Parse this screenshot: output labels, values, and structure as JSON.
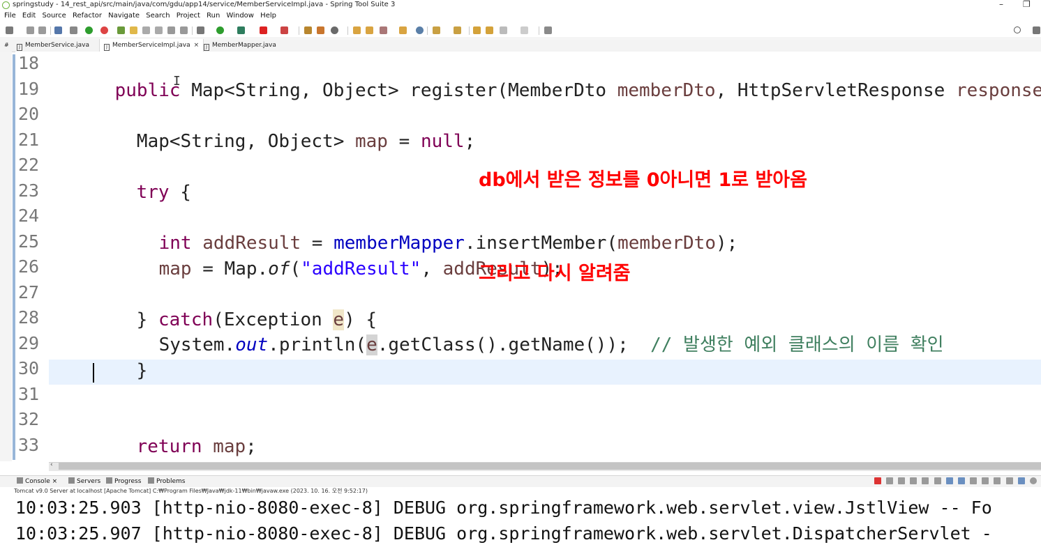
{
  "window": {
    "title": "springstudy - 14_rest_api/src/main/java/com/gdu/app14/service/MemberServiceImpl.java - Spring Tool Suite 3",
    "minimize": "–",
    "restore": "❐"
  },
  "menu": [
    "File",
    "Edit",
    "Source",
    "Refactor",
    "Navigate",
    "Search",
    "Project",
    "Run",
    "Window",
    "Help"
  ],
  "tabs": [
    {
      "label": "MemberService.java",
      "active": false
    },
    {
      "label": "MemberServiceImpl.java",
      "active": true
    },
    {
      "label": "MemberMapper.java",
      "active": false
    }
  ],
  "editor": {
    "line_numbers": [
      "18",
      "19",
      "20",
      "21",
      "22",
      "23",
      "24",
      "25",
      "26",
      "27",
      "28",
      "29",
      "30",
      "31",
      "32",
      "33"
    ],
    "code": {
      "l18": {
        "kw": "public",
        "t1": " Map<String, Object> register(MemberDto ",
        "v1": "memberDto",
        "t2": ", HttpServletResponse ",
        "v2": "response",
        "t3": ") {"
      },
      "l20": {
        "t1": "  Map<String, Object> ",
        "v1": "map",
        "t2": " = ",
        "kw": "null",
        "t3": ";"
      },
      "l22": {
        "kw": "try",
        "t1": " {"
      },
      "l24": {
        "kw": "int",
        "v1": "addResult",
        "t1": " = ",
        "f1": "memberMapper",
        "t2": ".insertMember(",
        "v2": "memberDto",
        "t3": ");"
      },
      "l25": {
        "v1": "map",
        "t1": " = Map.",
        "it": "of",
        "t2": "(",
        "st": "\"addResult\"",
        "t3": ", ",
        "v2": "addResult",
        "t4": ");"
      },
      "l27": {
        "t1": "} ",
        "kw": "catch",
        "t2": "(Exception ",
        "v1": "e",
        "t3": ") {"
      },
      "l28": {
        "t1": "System.",
        "f1": "out",
        "t2": ".println(",
        "v1": "e",
        "t3": ".getClass().getName());  ",
        "cm": "// 발생한 예외 클래스의 이름 확인"
      },
      "l29": {
        "t1": "}"
      },
      "l32": {
        "kw": "return",
        "v1": "map",
        "t1": ";"
      }
    }
  },
  "annotations": {
    "note1": "db에서 받은 정보를 0아니면 1로 받아옴",
    "note2": "그리고 다시 알려줌"
  },
  "console": {
    "tabs": [
      "Console",
      "Servers",
      "Progress",
      "Problems"
    ],
    "status": "Tomcat v9.0 Server at localhost [Apache Tomcat] C:₩Program Files₩Java₩jdk-11₩bin₩javaw.exe  (2023. 10. 16. 오전 9:52:17)",
    "lines": [
      "10:03:25.903 [http-nio-8080-exec-8] DEBUG org.springframework.web.servlet.view.JstlView -- Fo",
      "10:03:25.907 [http-nio-8080-exec-8] DEBUG org.springframework.web.servlet.DispatcherServlet -"
    ]
  },
  "colors": {
    "keyword": "#7f0055",
    "variable": "#6a3e3e",
    "field": "#0000c0",
    "string": "#2a00ff",
    "comment": "#3f7f5f",
    "annotation": "#ff0000",
    "current_line": "#e8f2fe"
  }
}
